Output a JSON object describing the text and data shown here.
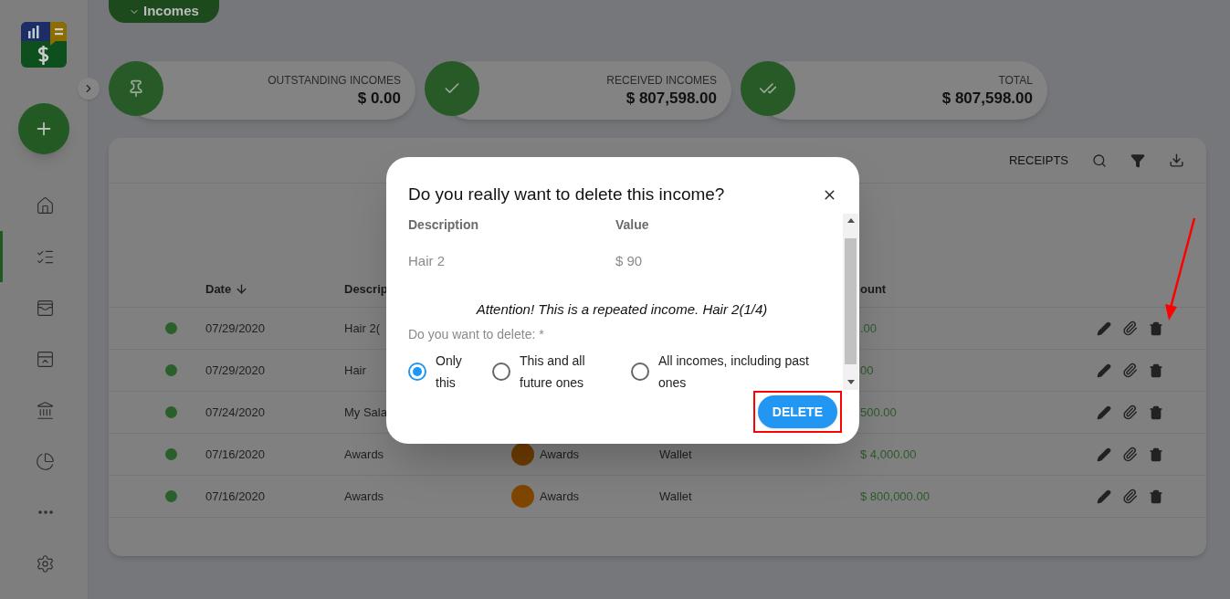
{
  "header_button": {
    "label": "Incomes"
  },
  "sidebar": {
    "items": [
      {
        "kind": "home",
        "selected": false
      },
      {
        "kind": "list",
        "selected": true
      },
      {
        "kind": "wallet",
        "selected": false
      },
      {
        "kind": "flag",
        "selected": false
      },
      {
        "kind": "bank",
        "selected": false
      },
      {
        "kind": "pie",
        "selected": false
      },
      {
        "kind": "more",
        "selected": false
      },
      {
        "kind": "settings",
        "selected": false
      }
    ]
  },
  "summary": [
    {
      "kind": "pin",
      "label": "OUTSTANDING INCOMES",
      "amount": "$ 0.00"
    },
    {
      "kind": "check",
      "label": "RECEIVED INCOMES",
      "amount": "$ 807,598.00"
    },
    {
      "kind": "double-check",
      "label": "TOTAL",
      "amount": "$ 807,598.00"
    }
  ],
  "toolbar": {
    "label": "RECEIPTS"
  },
  "table": {
    "columns": {
      "date": {
        "label": "Date",
        "sorted": true
      },
      "description": {
        "label": "Descrip",
        "sorted": false
      },
      "amount": {
        "label": "ount",
        "sorted": false
      }
    },
    "rows": [
      {
        "color": "#2a5e2a",
        "date": "07/29/2020",
        "description": "Hair 2(",
        "amount": ".00"
      },
      {
        "color": "#2a5e2a",
        "date": "07/29/2020",
        "description": "Hair",
        "amount": "00"
      },
      {
        "color": "#2a5e2a",
        "date": "07/24/2020",
        "description": "My Sala",
        "amount": "500.00"
      },
      {
        "color": "#2a5e2a",
        "date": "07/16/2020",
        "description": "Awards",
        "category": {
          "name": "Awards",
          "color": "#6e3c00"
        },
        "account": "Wallet",
        "amount": "$ 4,000.00"
      },
      {
        "color": "#2a5e2a",
        "date": "07/16/2020",
        "description": "Awards",
        "category": {
          "name": "Awards",
          "color": "#7f4600"
        },
        "account": "Wallet",
        "amount": "$ 800,000.00"
      }
    ]
  },
  "dialog": {
    "title": "Do you really want to delete this income?",
    "columns": [
      "Description",
      "Value"
    ],
    "values": [
      "Hair 2",
      "$ 90"
    ],
    "notice": "Attention! This is a repeated income. Hair 2(1/4)",
    "question": "Do you want to delete: *",
    "options": [
      {
        "label": "Only this",
        "selected": true
      },
      {
        "label": "This and all future ones",
        "selected": false
      },
      {
        "label": "All incomes, including past ones",
        "selected": false
      }
    ],
    "confirm": "DELETE"
  }
}
